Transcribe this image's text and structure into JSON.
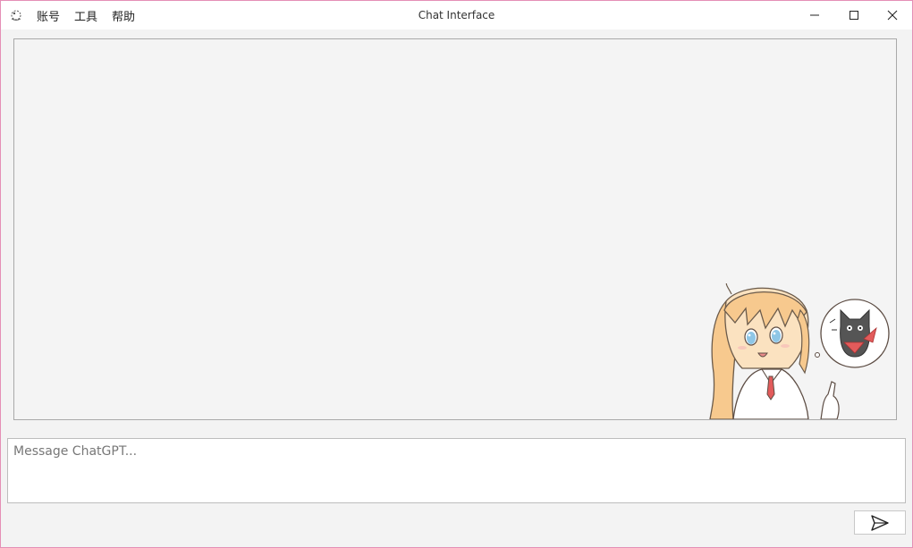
{
  "window": {
    "title": "Chat Interface"
  },
  "menu": {
    "items": [
      {
        "label": "账号"
      },
      {
        "label": "工具"
      },
      {
        "label": "帮助"
      }
    ]
  },
  "input": {
    "placeholder": "Message ChatGPT...",
    "value": ""
  },
  "send": {
    "icon": "send-icon"
  },
  "colors": {
    "border": "#e58fb6",
    "background": "#f3f3f3",
    "chat_bg": "#f4f4f4"
  }
}
